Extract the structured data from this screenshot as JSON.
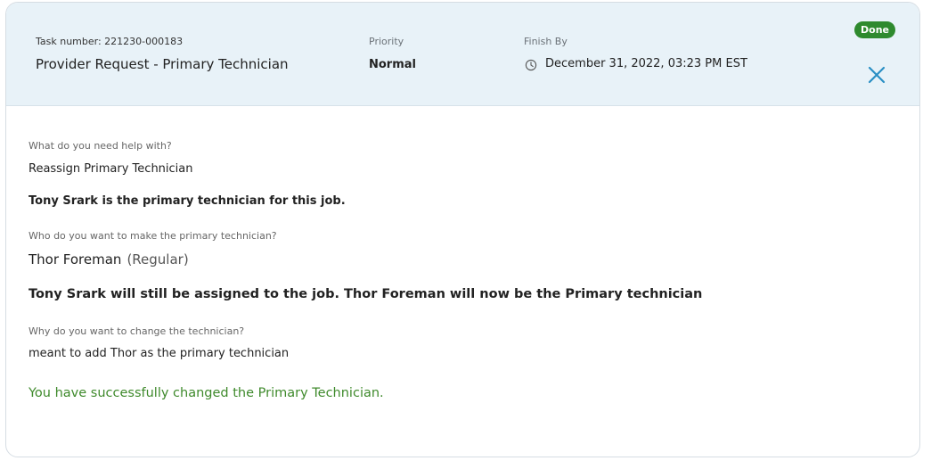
{
  "header": {
    "task_number": "Task number: 221230-000183",
    "title": "Provider Request - Primary Technician",
    "priority_label": "Priority",
    "priority_value": "Normal",
    "finish_label": "Finish By",
    "finish_value": "December 31, 2022, 03:23 PM EST",
    "status_badge": "Done",
    "clock_icon": "clock-icon",
    "close_icon": "close-icon"
  },
  "details": {
    "q1_label": "What do you need help with?",
    "q1_answer": "Reassign Primary Technician",
    "current_primary_note": "Tony Srark is the primary technician for this job.",
    "q2_label": "Who do you want to make the primary technician?",
    "q2_answer_name": "Thor Foreman",
    "q2_answer_role": "(Regular)",
    "assignment_note": "Tony Srark will still be assigned to the job. Thor Foreman will now be the Primary technician",
    "q3_label": "Why do you want to change the technician?",
    "q3_answer": "meant to add Thor as the primary technician",
    "success_message": "You have successfully changed the Primary Technician."
  },
  "colors": {
    "header_bg": "#e8f2f8",
    "done_badge": "#2e8a2e",
    "close_icon": "#2a8fc4",
    "success_text": "#3f8a2c"
  }
}
